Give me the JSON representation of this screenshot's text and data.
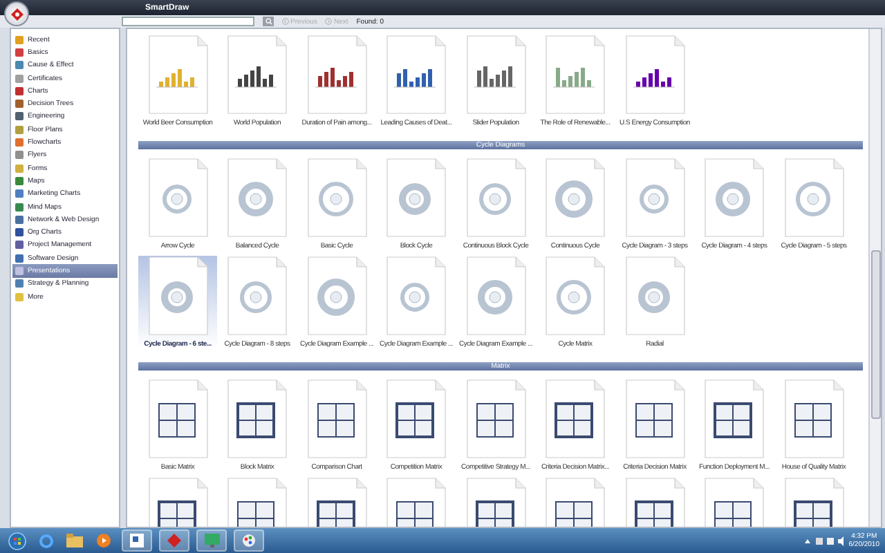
{
  "window": {
    "title": "SmartDraw"
  },
  "toolbar": {
    "previous": {
      "label": "Previous",
      "disabled": true
    },
    "next": {
      "label": "Next",
      "disabled": true
    },
    "found": "Found: 0"
  },
  "sidebar": {
    "items": [
      {
        "label": "Recent",
        "selected": false
      },
      {
        "label": "Basics",
        "selected": false
      },
      {
        "label": "Cause & Effect",
        "selected": false
      },
      {
        "label": "Certificates",
        "selected": false
      },
      {
        "label": "Charts",
        "selected": false
      },
      {
        "label": "Decision Trees",
        "selected": false
      },
      {
        "label": "Engineering",
        "selected": false
      },
      {
        "label": "Floor Plans",
        "selected": false
      },
      {
        "label": "Flowcharts",
        "selected": false
      },
      {
        "label": "Flyers",
        "selected": false
      },
      {
        "label": "Forms",
        "selected": false
      },
      {
        "label": "Maps",
        "selected": false
      },
      {
        "label": "Marketing Charts",
        "selected": false
      },
      {
        "label": "Mind Maps",
        "selected": false
      },
      {
        "label": "Network & Web Design",
        "selected": false
      },
      {
        "label": "Org Charts",
        "selected": false
      },
      {
        "label": "Project Management",
        "selected": false
      },
      {
        "label": "Software Design",
        "selected": false
      },
      {
        "label": "Presentations",
        "selected": true
      },
      {
        "label": "Strategy & Planning",
        "selected": false
      },
      {
        "label": "More",
        "selected": false
      }
    ]
  },
  "sections": [
    {
      "kind": "chart",
      "items": [
        {
          "label": "World Beer Consumption",
          "selected": false
        },
        {
          "label": "World Population",
          "selected": false
        },
        {
          "label": "Duration of Pain among...",
          "selected": false
        },
        {
          "label": "Leading Causes of Deat...",
          "selected": false
        },
        {
          "label": "Slider Population",
          "selected": false
        },
        {
          "label": "The Role of Renewable...",
          "selected": false
        },
        {
          "label": "U.S Energy Consumption",
          "selected": false
        }
      ]
    },
    {
      "kind": "cycle",
      "title": "Cycle Diagrams",
      "items": [
        {
          "label": "Arrow Cycle",
          "selected": false
        },
        {
          "label": "Balanced Cycle",
          "selected": false
        },
        {
          "label": "Basic Cycle",
          "selected": false
        },
        {
          "label": "Block Cycle",
          "selected": false
        },
        {
          "label": "Continuous Block Cycle",
          "selected": false
        },
        {
          "label": "Continuous Cycle",
          "selected": false
        },
        {
          "label": "Cycle Diagram - 3 steps",
          "selected": false
        },
        {
          "label": "Cycle Diagram - 4 steps",
          "selected": false
        },
        {
          "label": "Cycle Diagram - 5 steps",
          "selected": false
        },
        {
          "label": "Cycle Diagram - 6 ste...",
          "selected": true
        },
        {
          "label": "Cycle Diagram - 8 steps",
          "selected": false
        },
        {
          "label": "Cycle Diagram Example ...",
          "selected": false
        },
        {
          "label": "Cycle Diagram Example ...",
          "selected": false
        },
        {
          "label": "Cycle Diagram Example ...",
          "selected": false
        },
        {
          "label": "Cycle Matrix",
          "selected": false
        },
        {
          "label": "Radial",
          "selected": false
        }
      ]
    },
    {
      "kind": "matrix",
      "title": "Matrix",
      "items": [
        {
          "label": "Basic Matrix",
          "selected": false
        },
        {
          "label": "Block Matrix",
          "selected": false
        },
        {
          "label": "Comparison Chart",
          "selected": false
        },
        {
          "label": "Competition Matrix",
          "selected": false
        },
        {
          "label": "Competitive Strategy M...",
          "selected": false
        },
        {
          "label": "Criteria Decision Matrix...",
          "selected": false
        },
        {
          "label": "Criteria Decision Matrix",
          "selected": false
        },
        {
          "label": "Function Deployment M...",
          "selected": false
        },
        {
          "label": "House of Quality Matrix",
          "selected": false
        },
        {
          "selected": false
        },
        {
          "selected": false
        },
        {
          "selected": false
        },
        {
          "selected": false
        },
        {
          "selected": false
        },
        {
          "selected": false
        },
        {
          "selected": false
        },
        {
          "selected": false
        },
        {
          "selected": false
        }
      ]
    }
  ],
  "taskbar": {
    "time": "4:32 PM",
    "date": "6/20/2010"
  }
}
